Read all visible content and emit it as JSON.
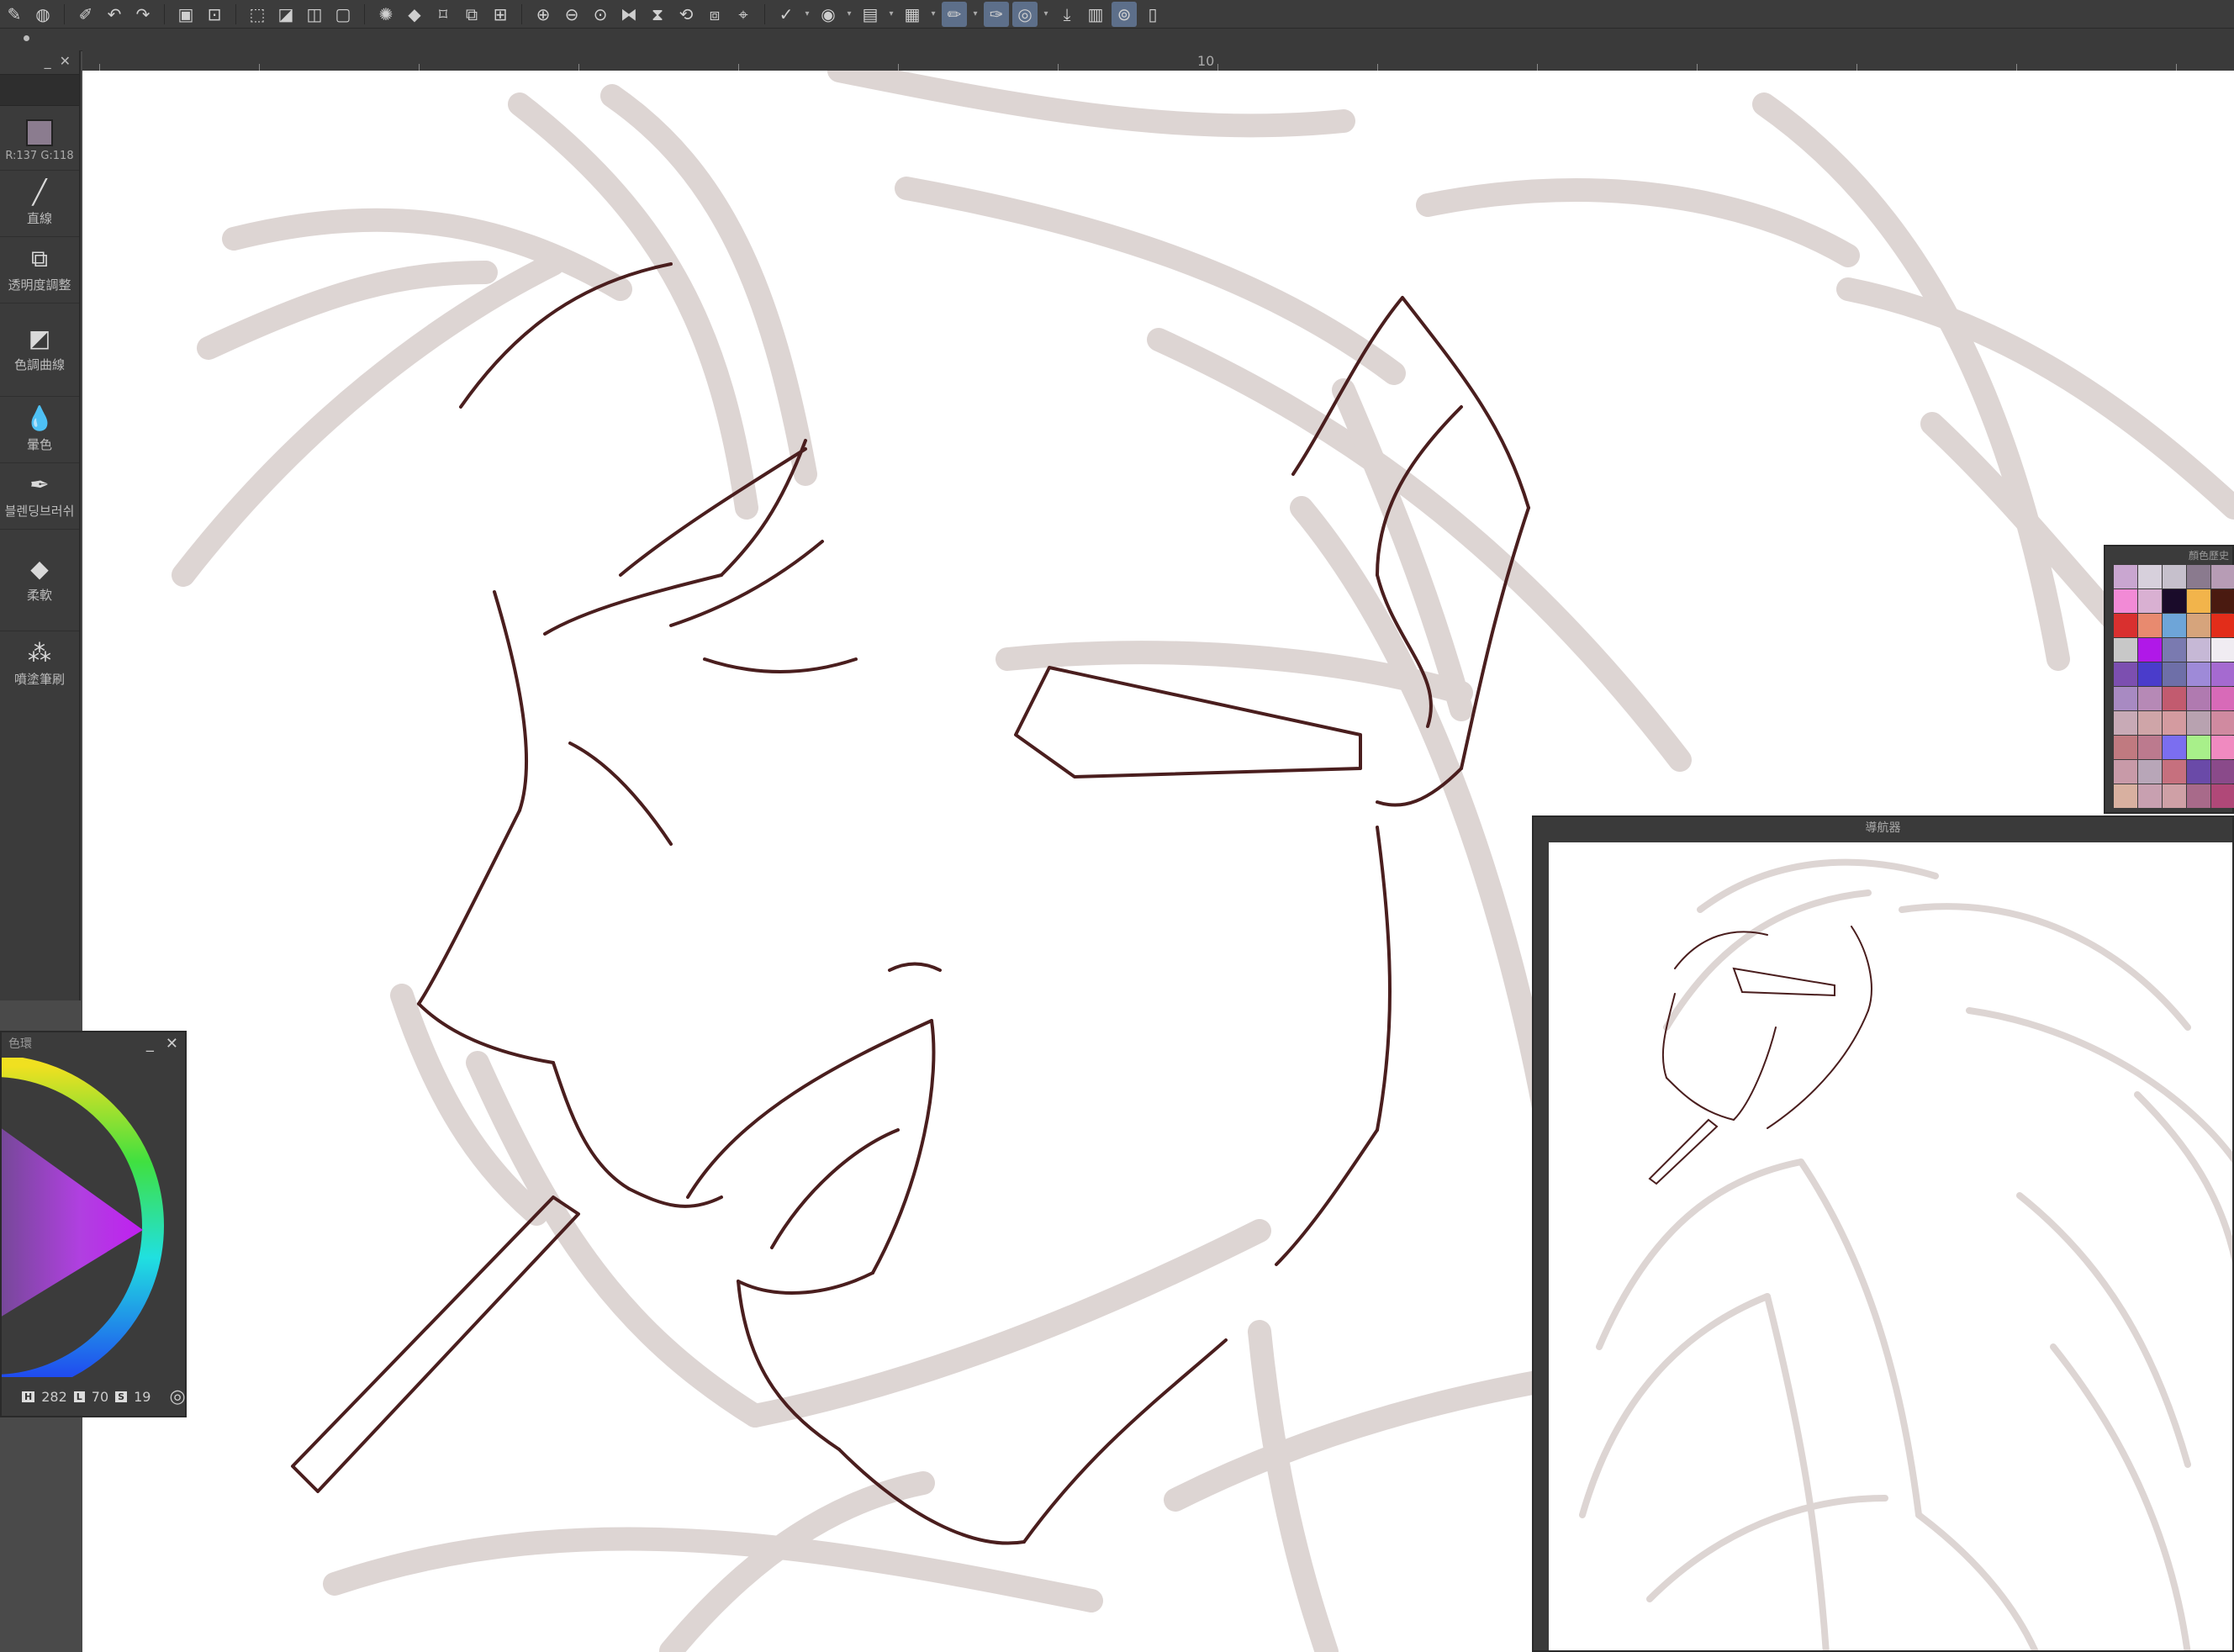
{
  "toolbar": {
    "icons": [
      "pen-icon",
      "globe-icon",
      "pencil-dropdown-icon",
      "undo-icon",
      "redo-icon",
      "canvas-icon",
      "frame-icon",
      "select-clear-icon",
      "invert-icon",
      "fill-selection-icon",
      "mask-icon",
      "lasso-icon",
      "fill-icon",
      "transform-icon",
      "mesh-icon",
      "grid-icon",
      "zoom-in-icon",
      "zoom-out-icon",
      "zoom-fit-icon",
      "flip-h-icon",
      "flip-v-icon",
      "rotate-icon",
      "snap-icon",
      "ruler-icon",
      "target-icon",
      "layer-icon",
      "save-icon",
      "brush-settings-icon",
      "eraser-settings-icon",
      "stabilizer-icon",
      "export-icon",
      "camera-icon",
      "search-icon",
      "device-icon"
    ]
  },
  "ruler": {
    "label": "10"
  },
  "left_panel": {
    "rgb_readout": "R:137 G:118",
    "tools": [
      {
        "icon": "line-icon",
        "label": "直線"
      },
      {
        "icon": "opacity-icon",
        "label": "透明度調整"
      },
      {
        "icon": "curve-icon",
        "label": "色調曲線"
      },
      {
        "icon": "blur-icon",
        "label": "暈色"
      },
      {
        "icon": "brush-icon",
        "label": "블렌딩브러쉬"
      },
      {
        "icon": "eraser-icon",
        "label": "柔軟"
      },
      {
        "icon": "spray-icon",
        "label": "噴塗筆刷"
      }
    ]
  },
  "color_wheel": {
    "title": "色環",
    "h_key": "H",
    "h_value": "282",
    "l_key": "L",
    "l_value": "70",
    "s_key": "S",
    "s_value": "19"
  },
  "palette": {
    "title": "顏色歷史",
    "colors": [
      "#c9a6d0",
      "#d7d0dc",
      "#c6c0cc",
      "#8a7a8e",
      "#b79cb5",
      "#f28ad6",
      "#d9b0d2",
      "#1a0b2a",
      "#f2b44b",
      "#4a1a10",
      "#d9302f",
      "#e88a6f",
      "#6ea5d8",
      "#d6a47c",
      "#e22d1a",
      "#c8c8c8",
      "#b018e8",
      "#7a7ab0",
      "#c6b8d6",
      "#f0ecf2",
      "#7c4fb0",
      "#4a3ccb",
      "#6e6fa8",
      "#9e8ad8",
      "#a56ad0",
      "#a88ac2",
      "#b689b6",
      "#c25b6f",
      "#b07ab0",
      "#d86ab8",
      "#c8aab6",
      "#cfa5a8",
      "#d49ba0",
      "#b8a2b0",
      "#d08aa0",
      "#c07a80",
      "#bc7a8e",
      "#7b6ef0",
      "#a8f08a",
      "#f08ac0",
      "#c89aa8",
      "#b8a6b8",
      "#c6707e",
      "#6a4aa8",
      "#8a4a8a",
      "#d8b0a0",
      "#c8a0b0",
      "#cfa0a6",
      "#a86a8a",
      "#b04878"
    ]
  },
  "navigator": {
    "title": "導航器"
  }
}
